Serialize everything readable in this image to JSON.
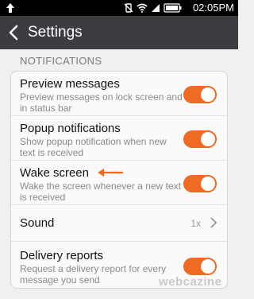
{
  "statusbar": {
    "time": "02:05PM"
  },
  "header": {
    "title": "Settings"
  },
  "section": {
    "title": "NOTIFICATIONS"
  },
  "items": [
    {
      "title": "Preview messages",
      "subtitle": "Preview messages on lock screen and in status bar",
      "toggle_on": true
    },
    {
      "title": "Popup notifications",
      "subtitle": "Show popup notification when new text is received",
      "toggle_on": true
    },
    {
      "title": "Wake screen",
      "subtitle": "Wake the screen whenever a new text is received",
      "toggle_on": true
    },
    {
      "title": "Sound",
      "value": "1x"
    },
    {
      "title": "Delivery reports",
      "subtitle": "Request a delivery report for every message you send",
      "toggle_on": true
    }
  ],
  "colors": {
    "accent": "#ef6a23",
    "titlebar": "#3b3d40",
    "statusbar": "#000000"
  },
  "watermark": "webcazine"
}
